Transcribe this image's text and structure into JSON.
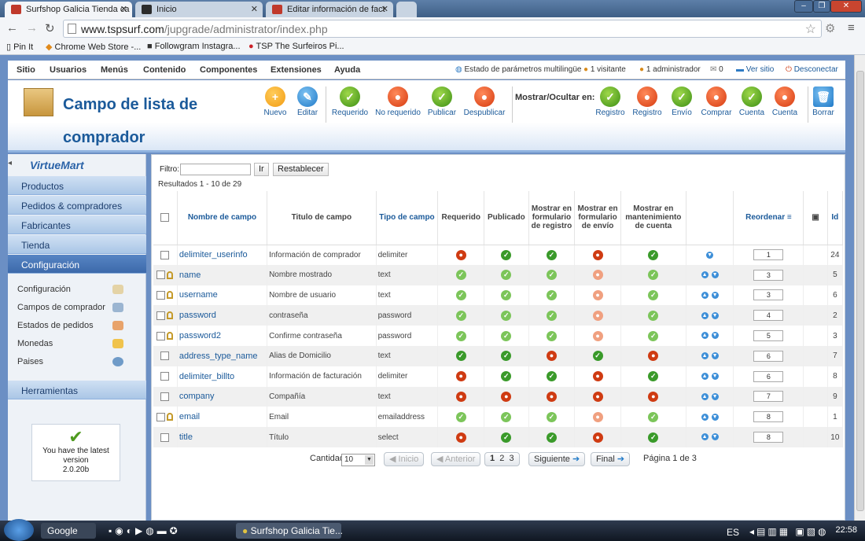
{
  "browser": {
    "tabs": [
      {
        "title": "Surfshop Galicia Tienda ca",
        "active": true
      },
      {
        "title": "Inicio",
        "active": false
      },
      {
        "title": "Editar información de fact",
        "active": false
      }
    ],
    "url_host": "www.tspsurf.com",
    "url_path": "/jupgrade/administrator/index.php",
    "bookmarks": [
      "Pin It",
      "Chrome Web Store -...",
      "Followgram Instagra...",
      "TSP The Surfeiros Pi..."
    ]
  },
  "topmenu": {
    "items": [
      "Sitio",
      "Usuarios",
      "Menús",
      "Contenido",
      "Componentes",
      "Extensiones",
      "Ayuda"
    ],
    "right": {
      "multilang": "Estado de parámetros multilingüe",
      "visitors": "1 visitante",
      "admins": "1 administrador",
      "messages": "0",
      "view_site": "Ver sitio",
      "logout": "Desconectar"
    }
  },
  "header": {
    "title_line1": "Campo de lista de",
    "title_line2": "comprador",
    "buttons": [
      "Nuevo",
      "Editar",
      "Requerido",
      "No requerido",
      "Publicar",
      "Despublicar"
    ],
    "show_hide_label": "Mostrar/Ocultar en:",
    "show_buttons": [
      "Registro",
      "Registro",
      "Envío",
      "Comprar",
      "Cuenta",
      "Cuenta"
    ],
    "delete": "Borrar"
  },
  "sidebar": {
    "logo": "VirtueMart",
    "nav": [
      "Productos",
      "Pedidos & compradores",
      "Fabricantes",
      "Tienda",
      "Configuración"
    ],
    "sub": [
      "Configuración",
      "Campos de comprador",
      "Estados de pedidos",
      "Monedas",
      "Paises"
    ],
    "tools": "Herramientas",
    "version": {
      "line1": "You have the latest",
      "line2": "version",
      "line3": "2.0.20b"
    }
  },
  "filter": {
    "label": "Filtro:",
    "go": "Ir",
    "reset": "Restablecer",
    "results": "Resultados 1 - 10 de 29"
  },
  "table": {
    "headers": {
      "name": "Nombre de campo",
      "title": "Titulo de campo",
      "type": "Tipo de campo",
      "required": "Requerido",
      "published": "Publicado",
      "show_reg": "Mostrar en formulario de registro",
      "show_ship": "Mostrar en formulario de envío",
      "show_acc": "Mostrar en mantenimiento de cuenta",
      "reorder": "Reordenar",
      "id": "Id"
    },
    "rows": [
      {
        "name": "delimiter_userinfo",
        "title": "Información de comprador",
        "type": "delimiter",
        "order": "1",
        "id": "24"
      },
      {
        "name": "name",
        "title": "Nombre mostrado",
        "type": "text",
        "order": "3",
        "id": "5"
      },
      {
        "name": "username",
        "title": "Nombre de usuario",
        "type": "text",
        "order": "3",
        "id": "6"
      },
      {
        "name": "password",
        "title": "contraseña",
        "type": "password",
        "order": "4",
        "id": "2"
      },
      {
        "name": "password2",
        "title": "Confirme contraseña",
        "type": "password",
        "order": "5",
        "id": "3"
      },
      {
        "name": "address_type_name",
        "title": "Alias de Domicilio",
        "type": "text",
        "order": "6",
        "id": "7"
      },
      {
        "name": "delimiter_billto",
        "title": "Información de facturación",
        "type": "delimiter",
        "order": "6",
        "id": "8"
      },
      {
        "name": "company",
        "title": "Compañía",
        "type": "text",
        "order": "7",
        "id": "9"
      },
      {
        "name": "email",
        "title": "Email",
        "type": "emailaddress",
        "order": "8",
        "id": "1"
      },
      {
        "name": "title",
        "title": "Título",
        "type": "select",
        "order": "8",
        "id": "10"
      }
    ]
  },
  "pagination": {
    "count_label": "Cantidad",
    "count_value": "10",
    "start": "Inicio",
    "prev": "Anterior",
    "pages": [
      "1",
      "2",
      "3"
    ],
    "next": "Siguiente",
    "last": "Final",
    "page_info": "Página 1 de 3"
  },
  "taskbar": {
    "google": "Google",
    "task": "Surfshop Galicia Tie...",
    "lang": "ES",
    "time": "22:58"
  }
}
